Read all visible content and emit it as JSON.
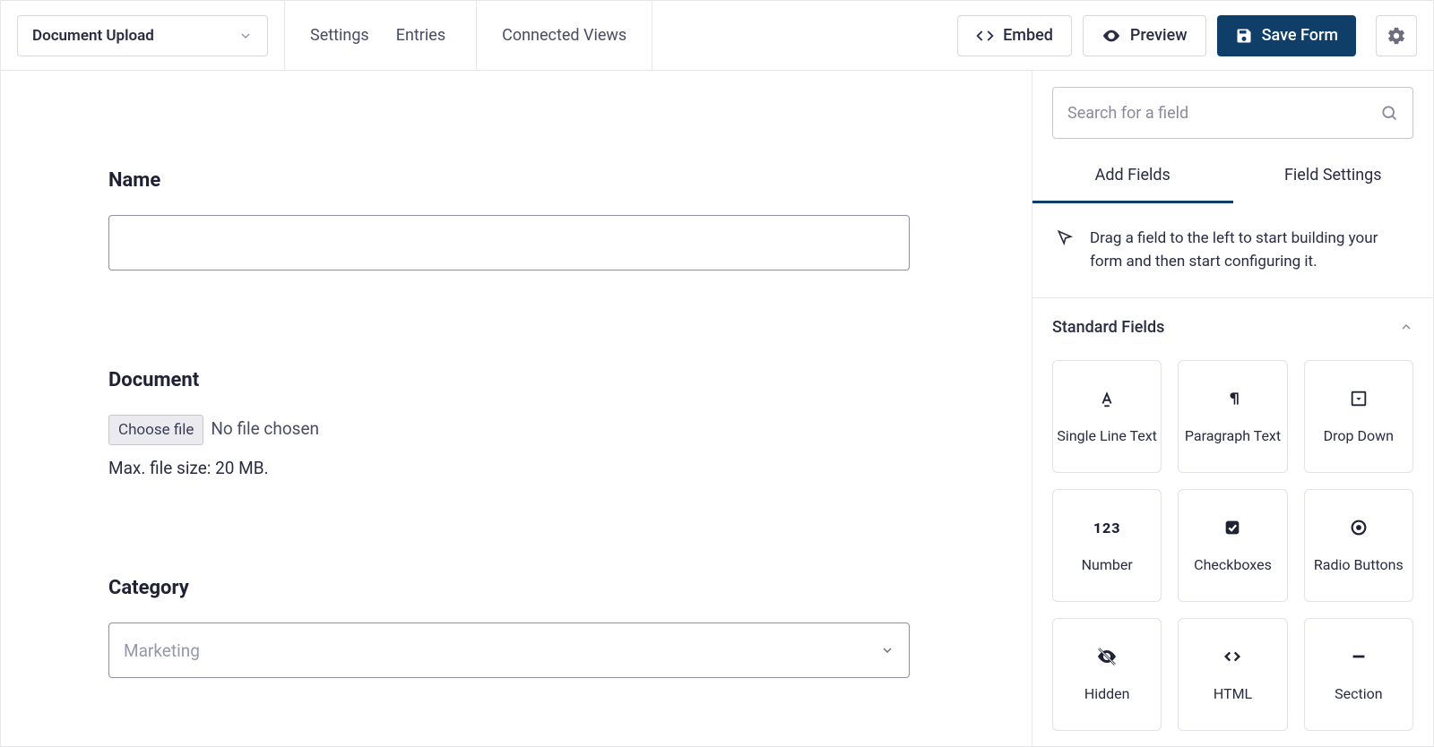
{
  "topbar": {
    "form_name": "Document Upload",
    "links": {
      "settings": "Settings",
      "entries": "Entries",
      "connected_views": "Connected Views"
    },
    "embed": "Embed",
    "preview": "Preview",
    "save": "Save Form"
  },
  "canvas": {
    "name_field": {
      "label": "Name",
      "value": ""
    },
    "document_field": {
      "label": "Document",
      "choose_file": "Choose file",
      "no_file": "No file chosen",
      "size_text": "Max. file size: 20 MB."
    },
    "category_field": {
      "label": "Category",
      "placeholder": "Marketing"
    }
  },
  "sidebar": {
    "search_placeholder": "Search for a field",
    "tabs": {
      "add": "Add Fields",
      "settings": "Field Settings"
    },
    "hint": "Drag a field to the left to start building your form and then start configuring it.",
    "section_title": "Standard Fields",
    "fields": [
      "Single Line Text",
      "Paragraph Text",
      "Drop Down",
      "Number",
      "Checkboxes",
      "Radio Buttons",
      "Hidden",
      "HTML",
      "Section"
    ]
  }
}
